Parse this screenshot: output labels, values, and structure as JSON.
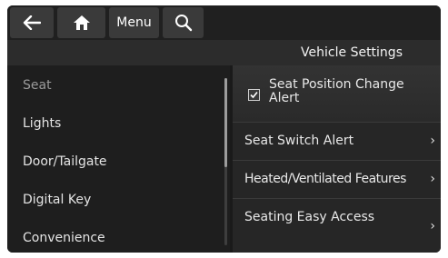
{
  "topbar": {
    "back_icon": "back-arrow-icon",
    "home_icon": "home-icon",
    "menu_label": "Menu",
    "search_icon": "search-icon"
  },
  "header": {
    "title": "Vehicle Settings"
  },
  "left_menu": {
    "items": [
      {
        "label": "Seat",
        "selected": true
      },
      {
        "label": "Lights"
      },
      {
        "label": "Door/Tailgate"
      },
      {
        "label": "Digital Key"
      },
      {
        "label": "Convenience"
      }
    ]
  },
  "right_menu": {
    "items": [
      {
        "label": "Seat Position Change Alert",
        "checked": true
      },
      {
        "label": "Seat Switch Alert",
        "chevron": "›"
      },
      {
        "label": "Heated/Ventilated Features",
        "chevron": "›"
      },
      {
        "label": "Seating Easy Access",
        "chevron": "›"
      }
    ]
  }
}
